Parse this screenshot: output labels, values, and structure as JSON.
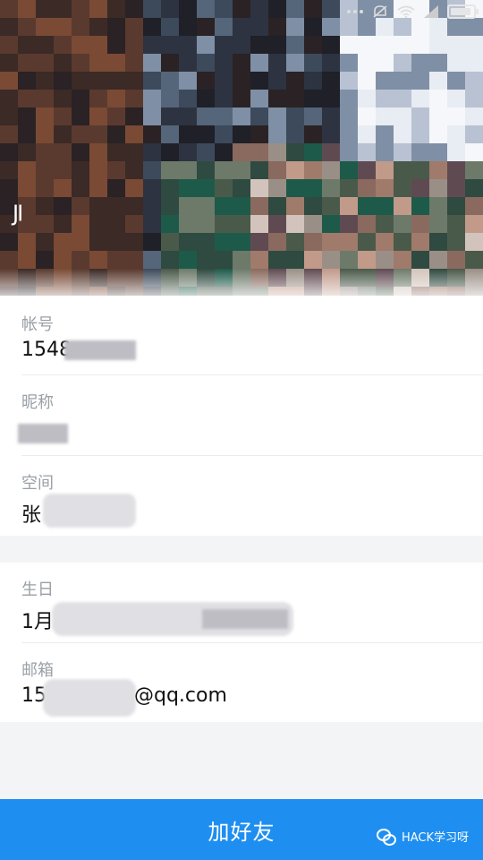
{
  "status_bar": {
    "left_text": ""
  },
  "header": {
    "name_fragment": "JI"
  },
  "profile": {
    "account": {
      "label": "帐号",
      "value": "1548"
    },
    "nickname": {
      "label": "昵称",
      "value": ""
    },
    "space": {
      "label": "空间",
      "value": "张"
    },
    "birthday": {
      "label": "生日",
      "value": "1月"
    },
    "email": {
      "label": "邮箱",
      "value_prefix": "15",
      "value_suffix": "@qq.com"
    }
  },
  "footer": {
    "add_friend_label": "加好友"
  },
  "watermark": {
    "text": "HACK学习呀",
    "icon": "wechat-icon"
  },
  "colors": {
    "accent": "#1e8ff0",
    "label": "#9aa0a6",
    "text": "#111111",
    "page_bg": "#f3f4f6"
  }
}
